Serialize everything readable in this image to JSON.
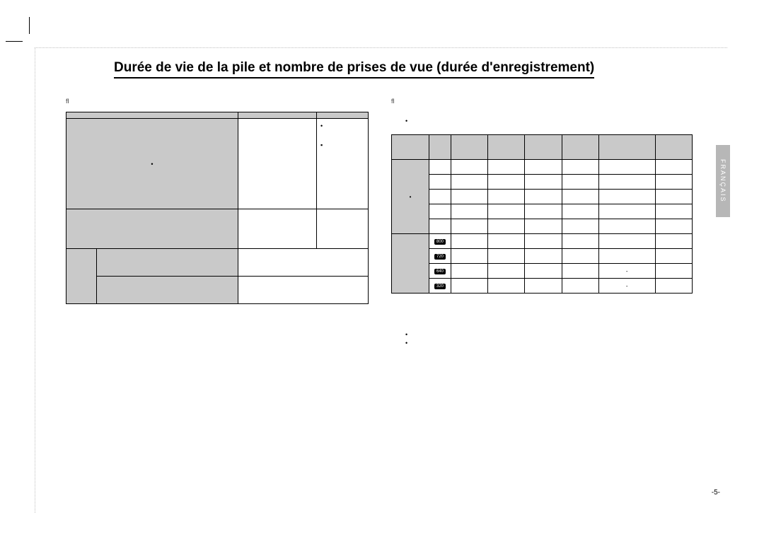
{
  "title": "Durée de vie de la pile et nombre de prises de vue (durée d'enregistrement)",
  "lang_tab": "FRANÇAIS",
  "page_number": "-5-",
  "left": {
    "note": "ﬂ",
    "headers": [
      "",
      "",
      ""
    ],
    "row_photo": {
      "label": "",
      "shots": "",
      "cond1": "",
      "cond2": ""
    },
    "row_video1": {
      "label": "",
      "shots": "",
      "cond": ""
    },
    "row_video2": {
      "group": "",
      "sub1": "",
      "val1": "",
      "sub2": "",
      "val2": ""
    }
  },
  "right": {
    "note": "ﬂ",
    "bullet_top": "",
    "headers": [
      "",
      "",
      "",
      "",
      "",
      "",
      "",
      ""
    ],
    "group_photo": "",
    "group_video": "",
    "photo_rows": [
      {
        "icon": "",
        "c0": "",
        "c1": "",
        "c2": "",
        "c3": "",
        "c4": "",
        "c5": ""
      },
      {
        "icon": "",
        "c0": "",
        "c1": "",
        "c2": "",
        "c3": "",
        "c4": "",
        "c5": ""
      },
      {
        "icon": "",
        "c0": "",
        "c1": "",
        "c2": "",
        "c3": "",
        "c4": "",
        "c5": ""
      },
      {
        "icon": "",
        "c0": "",
        "c1": "",
        "c2": "",
        "c3": "",
        "c4": "",
        "c5": ""
      },
      {
        "icon": "",
        "c0": "",
        "c1": "",
        "c2": "",
        "c3": "",
        "c4": "",
        "c5": ""
      }
    ],
    "video_rows": [
      {
        "icon": "800",
        "c0": "",
        "c1": "",
        "c2": "",
        "c3": "",
        "c4": "",
        "c5": ""
      },
      {
        "icon": "720",
        "c0": "",
        "c1": "",
        "c2": "",
        "c3": "",
        "c4": "",
        "c5": ""
      },
      {
        "icon": "640",
        "c0": "",
        "c1": "",
        "c2": "",
        "c3": "",
        "c4": "-",
        "c5": ""
      },
      {
        "icon": "320",
        "c0": "",
        "c1": "",
        "c2": "",
        "c3": "",
        "c4": "-",
        "c5": ""
      }
    ],
    "bullet_bottom1": "",
    "bullet_bottom2": ""
  }
}
